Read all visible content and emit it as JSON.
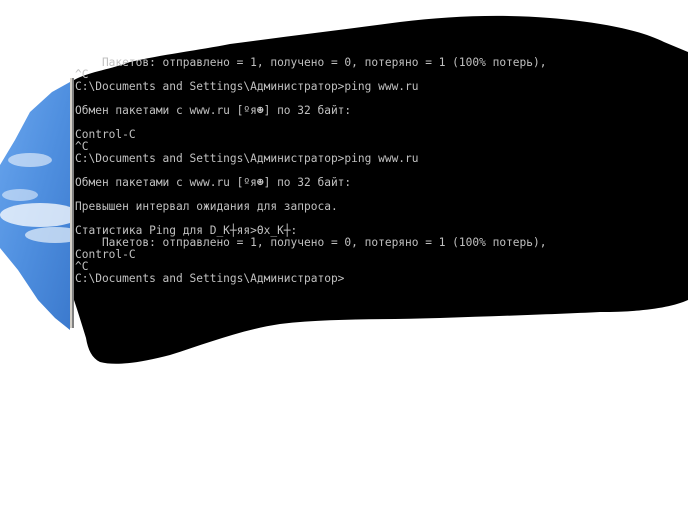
{
  "console": {
    "lines": [
      "    Пакетов: отправлено = 1, получено = 0, потеряно = 1 (100% потерь),",
      "^C",
      "C:\\Documents and Settings\\Администратор>ping www.ru",
      "",
      "Обмен пакетами с www.ru [ºя☻] по 32 байт:",
      "",
      "Control-C",
      "^C",
      "C:\\Documents and Settings\\Администратор>ping www.ru",
      "",
      "Обмен пакетами с www.ru [ºя☻] по 32 байт:",
      "",
      "Превышен интервал ожидания для запроса.",
      "",
      "Статистика Ping для D_К┼яя>Θх_К┼:",
      "    Пакетов: отправлено = 1, получено = 0, потеряно = 1 (100% потерь),",
      "Control-C",
      "^C",
      "C:\\Documents and Settings\\Администратор>"
    ]
  },
  "colors": {
    "console_background": "#000000",
    "console_text": "#c0c0c0",
    "wallpaper_sky": "#4f8fdf",
    "canvas_background": "#ffffff"
  }
}
